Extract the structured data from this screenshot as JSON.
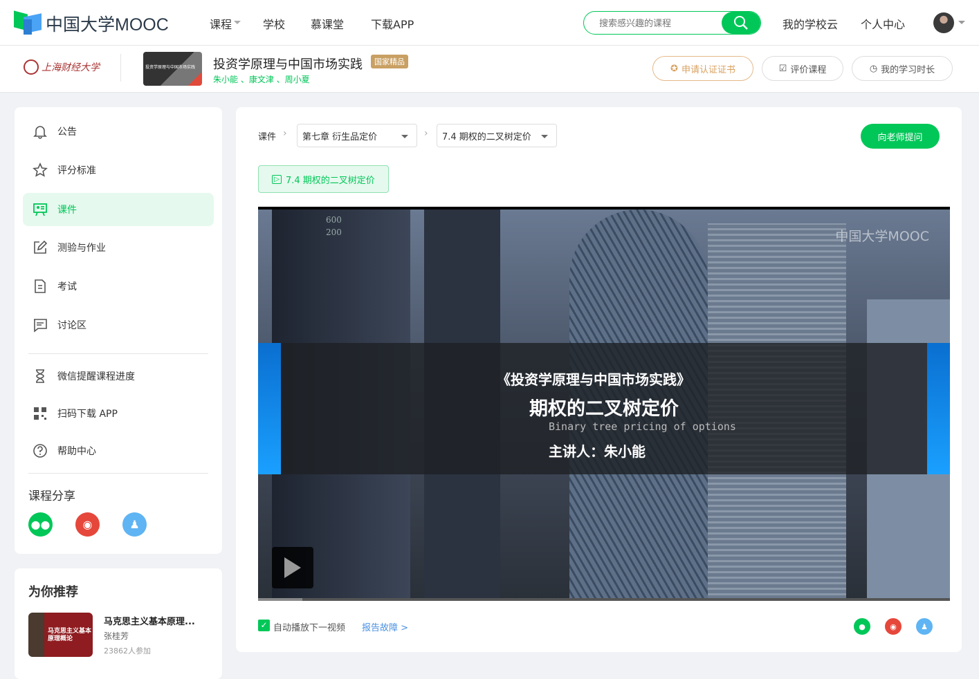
{
  "header": {
    "logo": "中国大学MOOC",
    "nav": [
      "课程",
      "学校",
      "慕课堂",
      "下载APP"
    ],
    "search_placeholder": "搜索感兴趣的课程",
    "school_cloud": "我的学校云",
    "personal_center": "个人中心"
  },
  "course": {
    "school": "上海财经大学",
    "cover_text": "投资学原理与中国市场实践",
    "title": "投资学原理与中国市场实践",
    "badge": "国家精品",
    "teachers": "朱小能 、康文津 、周小夏",
    "buttons": [
      "申请认证证书",
      "评价课程",
      "我的学习时长"
    ]
  },
  "sidebar": {
    "items": [
      {
        "label": "公告",
        "icon": "bell-icon"
      },
      {
        "label": "评分标准",
        "icon": "star-icon"
      },
      {
        "label": "课件",
        "icon": "courseware-icon"
      },
      {
        "label": "测验与作业",
        "icon": "edit-icon"
      },
      {
        "label": "考试",
        "icon": "document-icon"
      },
      {
        "label": "讨论区",
        "icon": "comment-icon"
      }
    ],
    "extra": [
      {
        "label": "微信提醒课程进度",
        "icon": "hourglass-icon"
      },
      {
        "label": "扫码下载 APP",
        "icon": "qrcode-icon"
      },
      {
        "label": "帮助中心",
        "icon": "help-icon"
      }
    ],
    "share_title": "课程分享"
  },
  "recommend": {
    "title": "为你推荐",
    "course_title": "马克思主义基本原理...",
    "cover_text": "马克思主义基本原理概论",
    "teacher": "张桂芳",
    "count": "23862人参加"
  },
  "main": {
    "breadcrumb_root": "课件",
    "chapter": "第七章 衍生品定价",
    "lesson": "7.4 期权的二叉树定价",
    "ask_button": "向老师提问",
    "unit_tab": "7.4 期权的二叉树定价",
    "video": {
      "watermark": "中国大学MOOC",
      "course_line": "《投资学原理与中国市场实践》",
      "title": "期权的二叉树定价",
      "subtitle_en": "Binary tree pricing of options",
      "presenter": "主讲人：朱小能",
      "bg_numbers": [
        "600",
        "200"
      ],
      "progress": 0.064
    },
    "autoplay_label": "自动播放下一视频",
    "autoplay_checked": true,
    "report": "报告故障 >"
  },
  "colors": {
    "accent": "#00c758",
    "gold": "#c9a063",
    "link": "#4a90e2"
  }
}
